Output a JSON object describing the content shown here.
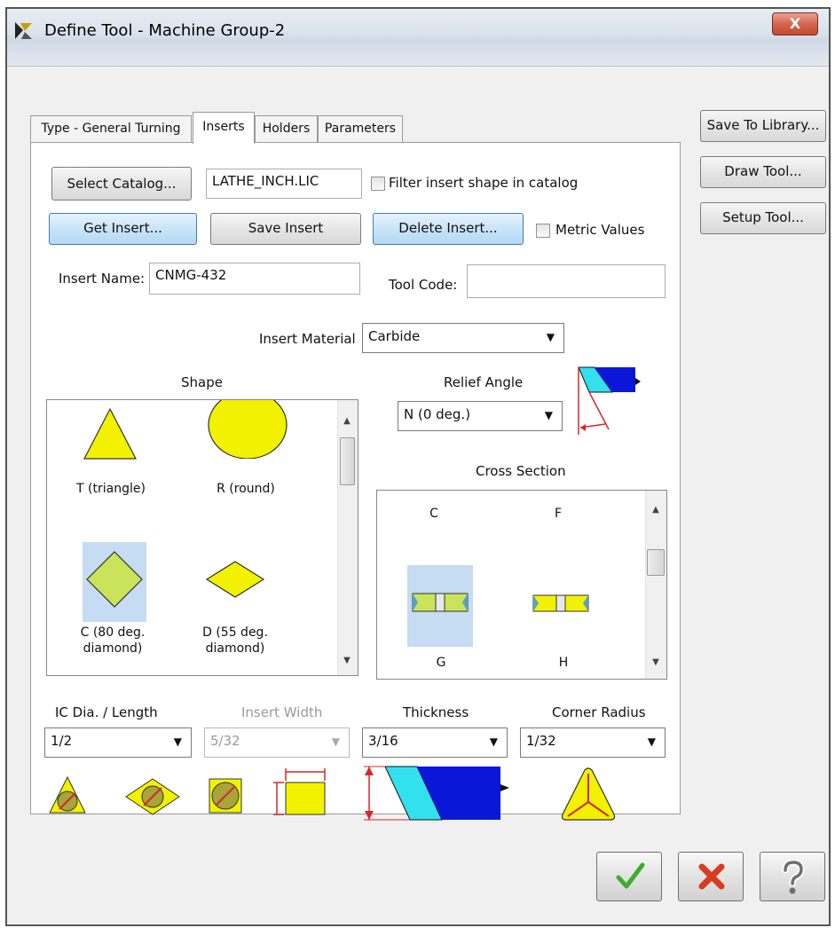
{
  "window": {
    "title": "Define Tool - Machine Group-2",
    "close_label": "X"
  },
  "tabs": [
    {
      "label": "Type - General Turning"
    },
    {
      "label": "Inserts"
    },
    {
      "label": "Holders"
    },
    {
      "label": "Parameters"
    }
  ],
  "side_buttons": {
    "save_to_library": "Save To Library...",
    "draw_tool": "Draw Tool...",
    "setup_tool": "Setup Tool..."
  },
  "catalog": {
    "select_catalog_label": "Select Catalog...",
    "catalog_file": "LATHE_INCH.LIC",
    "filter_label": "Filter insert shape in catalog",
    "filter_checked": false
  },
  "insert_actions": {
    "get_insert": "Get Insert...",
    "save_insert": "Save Insert",
    "delete_insert": "Delete Insert...",
    "metric_label": "Metric Values",
    "metric_checked": false
  },
  "insert_name": {
    "label": "Insert Name:",
    "value": "CNMG-432"
  },
  "tool_code": {
    "label": "Tool Code:",
    "value": ""
  },
  "insert_material": {
    "label": "Insert Material",
    "value": "Carbide"
  },
  "shape": {
    "heading": "Shape",
    "items": [
      {
        "label_line1": "T (triangle)",
        "label_line2": "",
        "selected": false
      },
      {
        "label_line1": "R (round)",
        "label_line2": "",
        "selected": false
      },
      {
        "label_line1": "C (80 deg.",
        "label_line2": "diamond)",
        "selected": true
      },
      {
        "label_line1": "D (55 deg.",
        "label_line2": "diamond)",
        "selected": false
      }
    ]
  },
  "relief_angle": {
    "label": "Relief Angle",
    "value": "N (0 deg.)"
  },
  "cross_section": {
    "heading": "Cross Section",
    "items": [
      {
        "label": "C",
        "selected": false
      },
      {
        "label": "F",
        "selected": false
      },
      {
        "label": "G",
        "selected": true
      },
      {
        "label": "H",
        "selected": false
      }
    ]
  },
  "dimensions": {
    "ic_dia": {
      "label": "IC Dia. / Length",
      "value": "1/2"
    },
    "insert_width": {
      "label": "Insert Width",
      "value": "5/32",
      "disabled": true
    },
    "thickness": {
      "label": "Thickness",
      "value": "3/16"
    },
    "corner_radius": {
      "label": "Corner Radius",
      "value": "1/32"
    }
  },
  "colors": {
    "insert_yellow": "#f2f200",
    "selection_blue": "#c5dcf2",
    "section_cyan": "#33e0ee",
    "section_blue": "#0a17d8",
    "dimension_red": "#d6272b",
    "ok_green": "#3cae2c",
    "cancel_red": "#d93b21"
  }
}
